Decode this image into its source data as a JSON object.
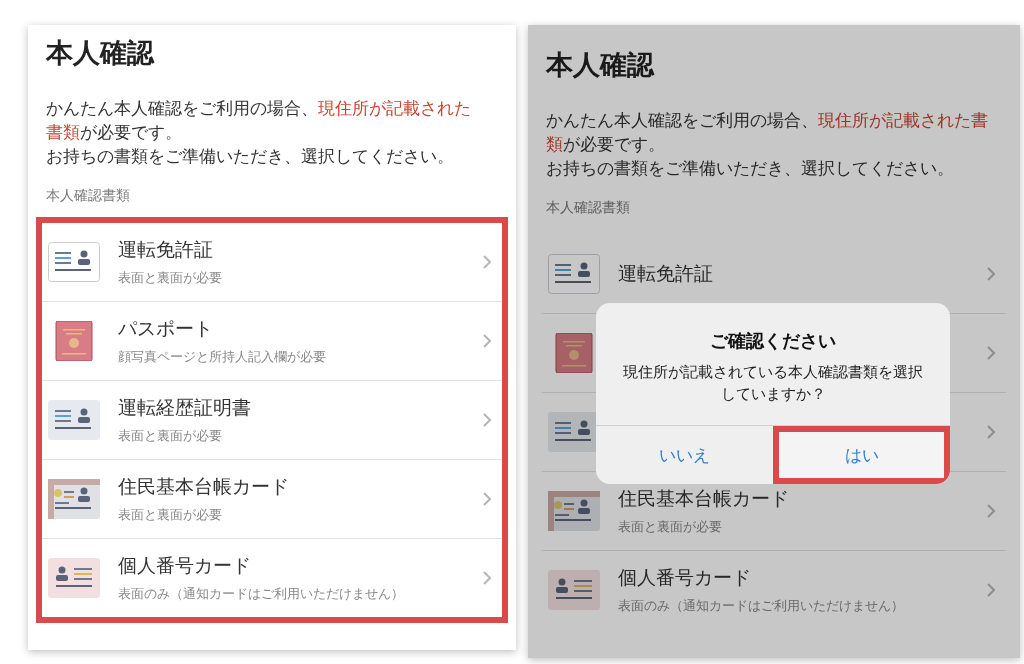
{
  "screens": [
    {
      "title": "本人確認",
      "description": [
        {
          "text": "かんたん本人確認をご利用の場合、",
          "emphasis": false
        },
        {
          "text": "現住所が記載された書類",
          "emphasis": true
        },
        {
          "text": "が必要です。",
          "emphasis": false
        }
      ],
      "instruction": "お持ちの書類をご準備いただき、選択してください。",
      "section_label": "本人確認書類",
      "list_highlighted": true,
      "dimmed": false,
      "documents": [
        {
          "kind": "license",
          "title": "運転免許証",
          "subtitle": "表面と裏面が必要"
        },
        {
          "kind": "passport",
          "title": "パスポート",
          "subtitle": "顔写真ページと所持人記入欄が必要"
        },
        {
          "kind": "history",
          "title": "運転経歴証明書",
          "subtitle": "表面と裏面が必要"
        },
        {
          "kind": "juki",
          "title": "住民基本台帳カード",
          "subtitle": "表面と裏面が必要"
        },
        {
          "kind": "mynumber",
          "title": "個人番号カード",
          "subtitle": "表面のみ（通知カードはご利用いただけません）"
        }
      ]
    },
    {
      "title": "本人確認",
      "description": [
        {
          "text": "かんたん本人確認をご利用の場合、",
          "emphasis": false
        },
        {
          "text": "現住所が記載された書類",
          "emphasis": true
        },
        {
          "text": "が必要です。",
          "emphasis": false
        }
      ],
      "instruction": "お持ちの書類をご準備いただき、選択してください。",
      "section_label": "本人確認書類",
      "list_highlighted": false,
      "dimmed": true,
      "documents": [
        {
          "kind": "license",
          "title": "運転免許証"
        },
        {
          "kind": "passport"
        },
        {
          "kind": "history"
        },
        {
          "kind": "juki",
          "title": "住民基本台帳カード",
          "subtitle": "表面と裏面が必要"
        },
        {
          "kind": "mynumber",
          "title": "個人番号カード",
          "subtitle": "表面のみ（通知カードはご利用いただけません）"
        }
      ],
      "dialog": {
        "title": "ご確認ください",
        "message": "現住所が記載されている本人確認書類を選択していますか？",
        "buttons": [
          {
            "label": "いいえ",
            "highlighted": false
          },
          {
            "label": "はい",
            "highlighted": true
          }
        ]
      }
    }
  ]
}
